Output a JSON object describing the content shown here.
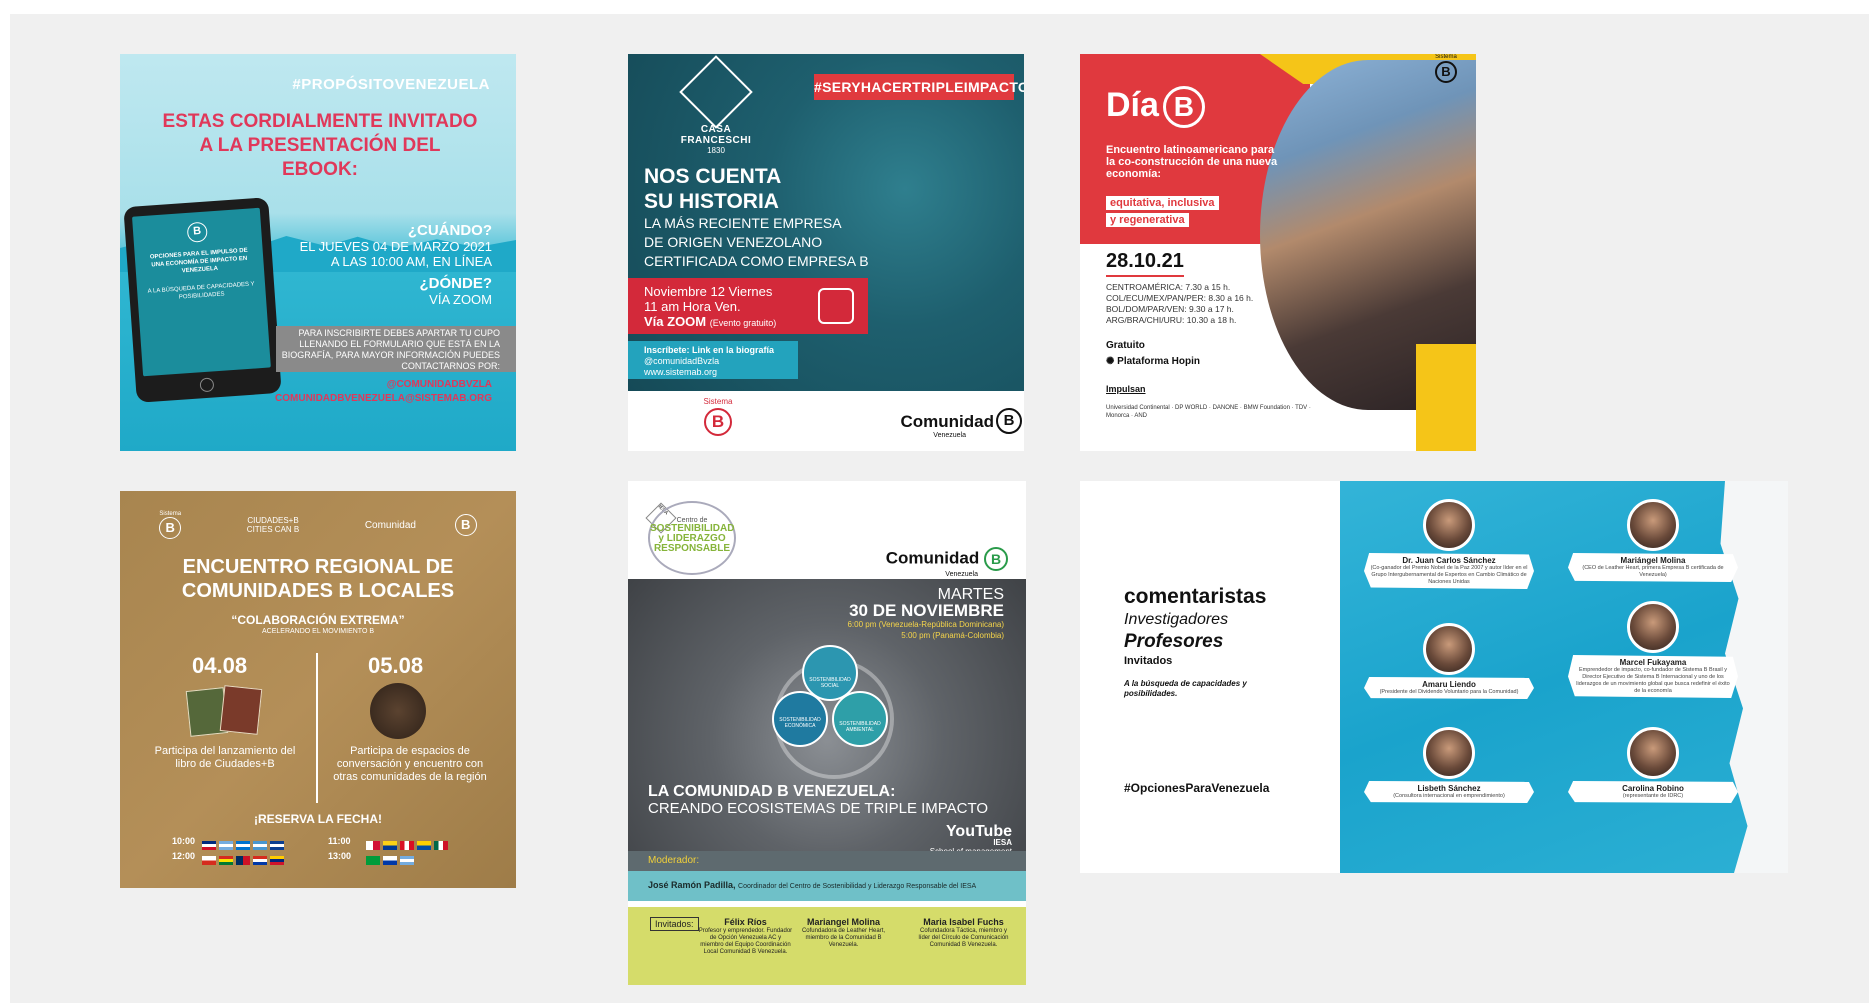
{
  "card1": {
    "hashtag": "#PROPÓSITOVENEZUELA",
    "invite_line1": "ESTAS CORDIALMENTE INVITADO",
    "invite_line2": "A LA PRESENTACIÓN DEL EBOOK:",
    "ebook_title": "OPCIONES PARA EL IMPULSO DE UNA ECONOMÍA DE IMPACTO EN VENEZUELA",
    "ebook_subtitle": "A LA BÚSQUEDA DE CAPACIDADES Y POSIBILIDADES",
    "when_q": "¿CUÁNDO?",
    "when_a1": "EL JUEVES 04 DE MARZO 2021",
    "when_a2": "A LAS 10:00 AM, EN LÍNEA",
    "where_q": "¿DÓNDE?",
    "where_a": "VÍA ZOOM",
    "register_text": "PARA INSCRIBIRTE DEBES APARTAR TU CUPO LLENANDO EL FORMULARIO QUE ESTÁ EN LA BIOGRAFÍA, PARA MAYOR INFORMACIÓN PUEDES CONTACTARNOS POR:",
    "handle": "@COMUNIDADBVZLA",
    "email": "COMUNIDADBVENEZUELA@SISTEMAB.ORG"
  },
  "card2": {
    "brand": "CASA FRANCESCHI",
    "year": "1830",
    "hashtag": "#SERYHACERTRIPLEIMPACTO",
    "headline1": "NOS CUENTA",
    "headline2": "SU HISTORIA",
    "sub1": "LA MÁS RECIENTE EMPRESA",
    "sub2": "DE ORIGEN VENEZOLANO",
    "sub3": "CERTIFICADA COMO EMPRESA B",
    "date1": "Noviembre 12 Viernes",
    "date2": "11 am Hora Ven.",
    "date3": "Vía ZOOM",
    "date3_note": "(Evento gratuito)",
    "insc1": "Inscríbete: Link en la biografía",
    "insc2": "@comunidadBvzla",
    "insc3": "www.sistemab.org",
    "sistema": "Sistema",
    "b_letter": "B",
    "comunidad": "Comunidad",
    "venezuela": "Venezuela"
  },
  "card3": {
    "dia": "Día",
    "b_letter": "B",
    "encuentro": "Encuentro latinoamericano para la co-construcción de una nueva economía:",
    "tag1": "equitativa, inclusiva",
    "tag2": "y regenerativa",
    "date": "28.10.21",
    "t1": "CENTROAMÉRICA: 7.30 a 15 h.",
    "t2": "COL/ECU/MEX/PAN/PER: 8.30 a 16 h.",
    "t3": "BOL/DOM/PAR/VEN: 9.30 a 17 h.",
    "t4": "ARG/BRA/CHI/URU: 10.30 a 18 h.",
    "gratuito": "Gratuito",
    "plataforma": "Plataforma Hopin",
    "impulsan": "Impulsan",
    "sponsors": "Universidad Continental · DP WORLD · DANONE · BMW Foundation · TDV · Monorca · AND",
    "sistema": "Sistema"
  },
  "card4": {
    "sistema": "Sistema",
    "b_letter": "B",
    "ciudades": "CIUDADES+B CITIES CAN B",
    "comunidad": "Comunidad",
    "title1": "ENCUENTRO REGIONAL DE",
    "title2": "COMUNIDADES B LOCALES",
    "subtitle": "“COLABORACIÓN EXTREMA”",
    "subtitle2": "ACELERANDO EL MOVIMIENTO B",
    "date1": "04.08",
    "date2": "05.08",
    "p1": "Participa del lanzamiento del libro de Ciudades+B",
    "p2": "Participa de espacios de conversación y encuentro con otras comunidades de la región",
    "reserve": "¡RESERVA LA FECHA!",
    "t1000a": "10:00",
    "t1200": "12:00",
    "t1100": "11:00",
    "t1300": "13:00"
  },
  "card5": {
    "centro1": "Centro de",
    "centro2": "SOSTENIBILIDAD",
    "centro3": "y LIDERAZGO",
    "centro4": "RESPONSABLE",
    "iesa": "IESA",
    "comunidad": "Comunidad",
    "b_letter": "B",
    "venezuela": "Venezuela",
    "martes": "MARTES",
    "fecha": "30 DE NOVIEMBRE",
    "hora1": "6:00 pm (Venezuela-República Dominicana)",
    "hora2": "5:00 pm (Panamá-Colombia)",
    "sost_social": "SOSTENIBILIDAD SOCIAL",
    "sost_econ": "SOSTENIBILIDAD ECONÓMICA",
    "sost_amb": "SOSTENIBILIDAD AMBIENTAL",
    "title1": "LA COMUNIDAD B VENEZUELA:",
    "title2": "CREANDO ECOSISTEMAS DE TRIPLE IMPACTO",
    "youtube": "YouTube",
    "iesa2": "IESA",
    "school": "School of management",
    "moderador": "Moderador:",
    "moderador_name": "José Ramón Padilla,",
    "moderador_desc": "Coordinador del Centro de Sostenibilidad y Liderazgo Responsable del IESA",
    "invitados": "Invitados:",
    "inv1_name": "Félix Ríos",
    "inv1_desc": "Profesor y emprendedor. Fundador de Opción Venezuela AC y miembro del Equipo Coordinación Local Comunidad B Venezuela.",
    "inv2_name": "Mariangel Molina",
    "inv2_desc": "Cofundadora de Leather Heart, miembro de la Comunidad B Venezuela.",
    "inv3_name": "Maria Isabel Fuchs",
    "inv3_desc": "Cofundadora Táctica, miembro y líder del Círculo de Comunicación Comunidad B Venezuela."
  },
  "card6": {
    "l1": "comentaristas",
    "l2": "Investigadores",
    "l3": "Profesores",
    "l4": "Invitados",
    "l5": "A la búsqueda de capacidades y posibilidades.",
    "hashtag": "#OpcionesParaVenezuela",
    "speakers": [
      {
        "name": "Dr. Juan Carlos Sánchez",
        "desc": "(Co-ganador del Premio Nobel de la Paz 2007 y autor líder en el Grupo Intergubernamental de Expertos en Cambio Climático de Naciones Unidas"
      },
      {
        "name": "Mariángel Molina",
        "desc": "(CEO de Leather Heart, primera Empresa B certificada de Venezuela)"
      },
      {
        "name": "Amaru Liendo",
        "desc": "(Presidente del Dividendo Voluntario para la Comunidad)"
      },
      {
        "name": "Marcel Fukayama",
        "desc": "Emprendedor de impacto, co-fundador de Sistema B Brasil y Director Ejecutivo de Sistema B Internacional y uno de los liderazgos de un movimiento global que busca redefinir el éxito de la economía"
      },
      {
        "name": "Lisbeth Sánchez",
        "desc": "(Consultora internacional en emprendimiento)"
      },
      {
        "name": "Carolina Robino",
        "desc": "(representante de IDRC)"
      }
    ]
  },
  "colors": {
    "accent_red": "#e0393e",
    "accent_cyan": "#1fa9c8",
    "teal_dark": "#154a57",
    "kraft": "#a8854f",
    "olive_yellow": "#d5dc6a"
  }
}
